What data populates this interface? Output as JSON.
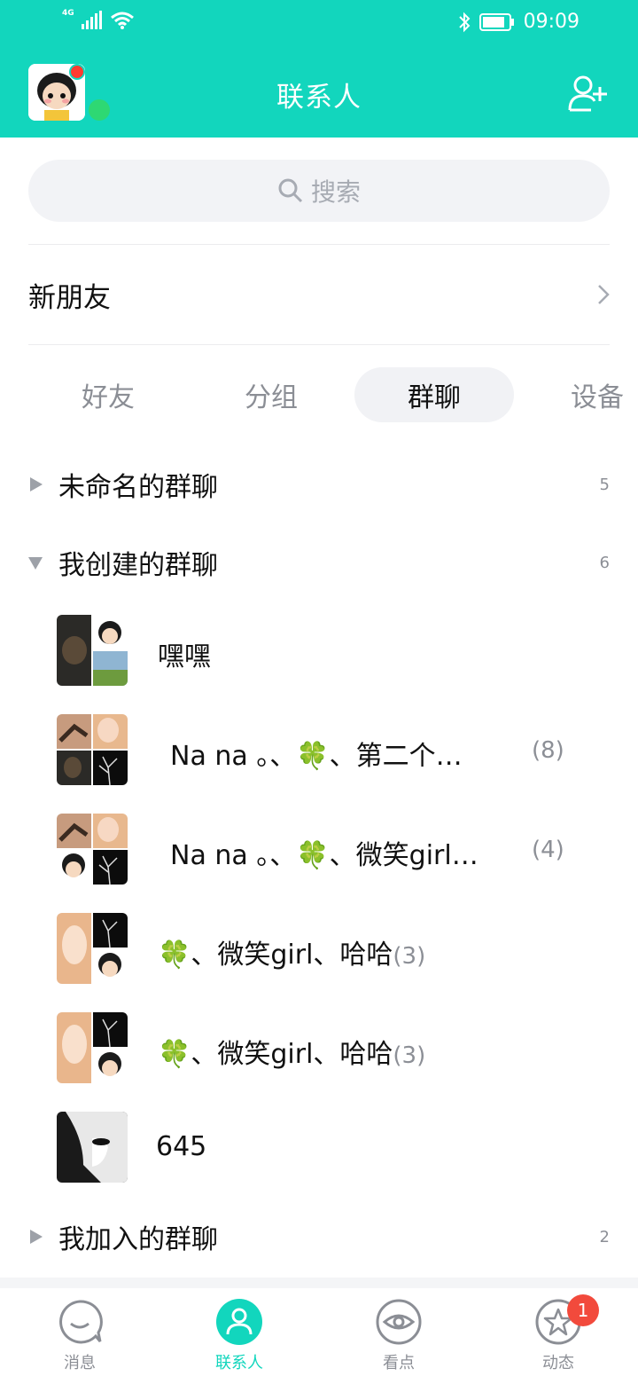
{
  "status_bar": {
    "network": "4G",
    "time": "09:09"
  },
  "header": {
    "title": "联系人"
  },
  "search": {
    "placeholder": "搜索"
  },
  "new_friends": {
    "label": "新朋友"
  },
  "tabs": [
    {
      "label": "好友",
      "active": false
    },
    {
      "label": "分组",
      "active": false
    },
    {
      "label": "群聊",
      "active": true
    },
    {
      "label": "设备",
      "active": false
    }
  ],
  "groups": [
    {
      "name": "未命名的群聊",
      "count": "5",
      "expanded": false
    },
    {
      "name": "我创建的群聊",
      "count": "6",
      "expanded": true
    },
    {
      "name": "我加入的群聊",
      "count": "2",
      "expanded": false
    }
  ],
  "chats": [
    {
      "name": "嘿嘿",
      "count": ""
    },
    {
      "name": "Na  na 。、🍀、第二个…",
      "count": "(8)"
    },
    {
      "name": "Na  na 。、🍀、微笑girl…",
      "count": "(4)"
    },
    {
      "name": "🍀、微笑girl、哈哈",
      "count": "(3)"
    },
    {
      "name": "🍀、微笑girl、哈哈",
      "count": "(3)"
    },
    {
      "name": "645",
      "count": ""
    }
  ],
  "bottom_nav": [
    {
      "label": "消息",
      "icon": "message-icon",
      "active": false
    },
    {
      "label": "联系人",
      "icon": "contacts-icon",
      "active": true
    },
    {
      "label": "看点",
      "icon": "eye-icon",
      "active": false
    },
    {
      "label": "动态",
      "icon": "star-icon",
      "active": false,
      "badge": "1"
    }
  ],
  "colors": {
    "accent": "#12d6bd",
    "badge": "#f24a3c",
    "online": "#2ed873"
  }
}
